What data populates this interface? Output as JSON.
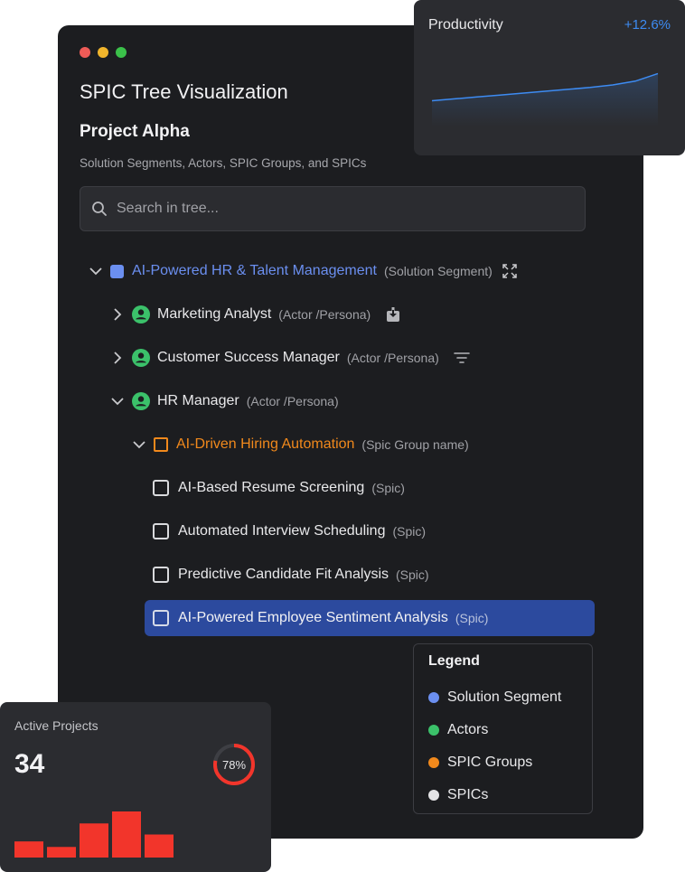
{
  "window": {
    "title": "SPIC Tree Visualization",
    "traffic_colors": [
      "#ee5b57",
      "#f1b52c",
      "#3bc14a"
    ]
  },
  "project": {
    "title": "Project Alpha",
    "subtitle": "Solution Segments, Actors, SPIC Groups, and SPICs"
  },
  "search": {
    "placeholder": "Search in tree..."
  },
  "tree": {
    "segment": {
      "label": "AI-Powered HR & Talent Management",
      "type": "(Solution Segment)",
      "color": "#6b8ff0"
    },
    "actors": [
      {
        "label": "Marketing Analyst",
        "type": "(Actor /Persona)",
        "expanded": false,
        "icon": "download-icon"
      },
      {
        "label": "Customer Success Manager",
        "type": "(Actor /Persona)",
        "expanded": false,
        "icon": "filter-icon"
      },
      {
        "label": "HR Manager",
        "type": "(Actor /Persona)",
        "expanded": true
      }
    ],
    "group": {
      "label": "AI-Driven Hiring Automation",
      "type": "(Spic Group name)",
      "color": "#f1891c"
    },
    "spics": [
      {
        "label": "AI-Based Resume Screening",
        "type": "(Spic)"
      },
      {
        "label": "Automated Interview Scheduling",
        "type": "(Spic)"
      },
      {
        "label": "Predictive Candidate Fit Analysis",
        "type": "(Spic)"
      },
      {
        "label": "AI-Powered Employee Sentiment Analysis",
        "type": "(Spic)",
        "selected": true
      }
    ],
    "actor_color": "#3bc16a"
  },
  "legend": {
    "title": "Legend",
    "items": [
      {
        "label": "Solution Segment",
        "color": "#6b8ff0"
      },
      {
        "label": "Actors",
        "color": "#3bc16a"
      },
      {
        "label": "SPIC Groups",
        "color": "#f1891c"
      },
      {
        "label": "SPICs",
        "color": "#e4e4e6"
      }
    ]
  },
  "productivity": {
    "title": "Productivity",
    "change": "+12.6%",
    "line_color": "#3d8bf2",
    "trend": [
      0.35,
      0.38,
      0.41,
      0.44,
      0.47,
      0.5,
      0.53,
      0.56,
      0.6,
      0.66,
      0.78
    ]
  },
  "active_projects": {
    "title": "Active Projects",
    "value": "34",
    "percent_label": "78%",
    "percent": 0.78,
    "accent": "#f2352b",
    "bars": [
      0.35,
      0.23,
      0.74,
      1.0,
      0.5
    ]
  }
}
